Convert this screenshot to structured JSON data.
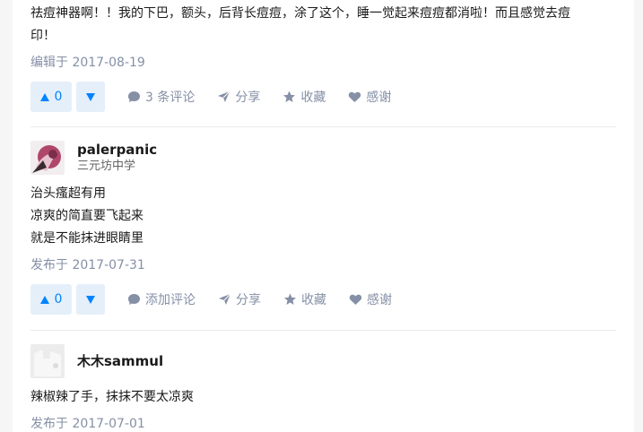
{
  "answers": [
    {
      "content": [
        "祛痘神器啊！！我的下巴，额头，后背长痘痘，涂了这个，睡一觉起来痘痘都消啦！而且感觉去痘",
        "印！"
      ],
      "time": "编辑于 2017-08-19",
      "votes": "0",
      "comment_label": "3 条评论",
      "share_label": "分享",
      "collect_label": "收藏",
      "thanks_label": "感谢"
    },
    {
      "author": "palerpanic",
      "bio": "三元坊中学",
      "content": [
        "治头瘙超有用",
        "凉爽的简直要飞起来",
        "就是不能抹进眼睛里"
      ],
      "time": "发布于 2017-07-31",
      "votes": "0",
      "comment_label": "添加评论",
      "share_label": "分享",
      "collect_label": "收藏",
      "thanks_label": "感谢"
    },
    {
      "author": "木木sammul",
      "content": [
        "辣椒辣了手，抹抹不要太凉爽"
      ],
      "time": "发布于 2017-07-01"
    }
  ],
  "colors": {
    "accent": "#0084ff",
    "vote_bg": "#e5effa",
    "meta": "#8590a6"
  }
}
